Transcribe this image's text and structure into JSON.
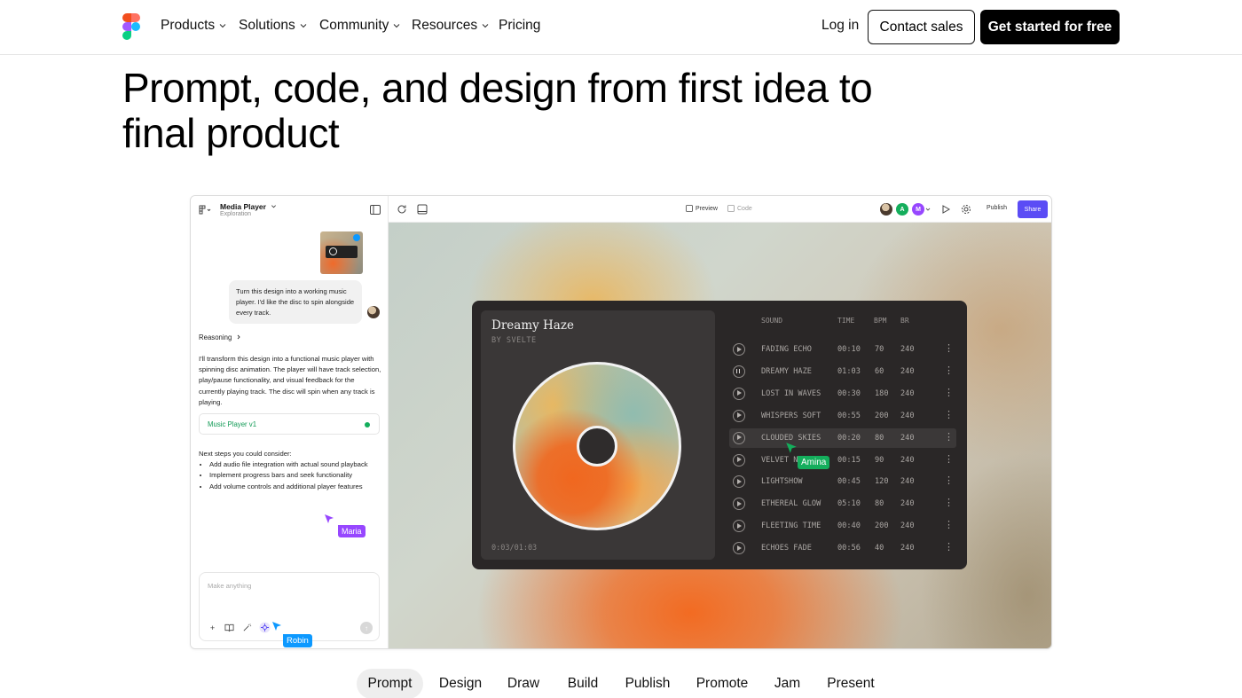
{
  "nav": {
    "items": [
      "Products",
      "Solutions",
      "Community",
      "Resources",
      "Pricing"
    ],
    "login": "Log in",
    "contact": "Contact sales",
    "cta": "Get started for free"
  },
  "hero": {
    "line1": "Prompt, code, and design from first idea to",
    "line2": "final product"
  },
  "app": {
    "project_title": "Media Player",
    "project_subtitle": "Exploration",
    "user_message": "Turn this design into a working music player. I'd like the disc to spin alongside every track.",
    "reasoning_label": "Reasoning",
    "response": "I'll transform this design into a functional music player with spinning disc animation. The player will have track selection, play/pause functionality, and visual feedback for the currently playing track. The disc will spin when any track is playing.",
    "card_label": "Music Player v1",
    "next_intro": "Next steps you could consider:",
    "next_steps": [
      "Add audio file integration with actual sound playback",
      "Implement progress bars and seek functionality",
      "Add volume controls and additional player features"
    ],
    "input_placeholder": "Make anything",
    "cursors": {
      "maria": "Maria",
      "robin": "Robin",
      "amina": "Amina"
    },
    "topbar": {
      "preview": "Preview",
      "code": "Code",
      "avatar_a": "A",
      "avatar_m": "M",
      "publish": "Publish",
      "share": "Share"
    },
    "colors": {
      "share": "#5b4cf5",
      "maria": "#9747ff",
      "robin": "#0d99ff",
      "amina": "#14ae5c",
      "card_dot": "#14ae5c"
    }
  },
  "player": {
    "title": "Dreamy Haze",
    "artist": "BY SVELTE",
    "time": "0:03/01:03",
    "columns": [
      "SOUND",
      "TIME",
      "BPM",
      "BR"
    ],
    "tracks": [
      {
        "name": "FADING ECHO",
        "time": "00:10",
        "bpm": "70",
        "br": "240"
      },
      {
        "name": "DREAMY HAZE",
        "time": "01:03",
        "bpm": "60",
        "br": "240"
      },
      {
        "name": "LOST IN WAVES",
        "time": "00:30",
        "bpm": "180",
        "br": "240"
      },
      {
        "name": "WHISPERS SOFT",
        "time": "00:55",
        "bpm": "200",
        "br": "240"
      },
      {
        "name": "CLOUDED SKIES",
        "time": "00:20",
        "bpm": "80",
        "br": "240"
      },
      {
        "name": "VELVET N",
        "time": "00:15",
        "bpm": "90",
        "br": "240"
      },
      {
        "name": "LIGHTSHOW",
        "time": "00:45",
        "bpm": "120",
        "br": "240"
      },
      {
        "name": "ETHEREAL GLOW",
        "time": "05:10",
        "bpm": "80",
        "br": "240"
      },
      {
        "name": "FLEETING TIME",
        "time": "00:40",
        "bpm": "200",
        "br": "240"
      },
      {
        "name": "ECHOES FADE",
        "time": "00:56",
        "bpm": "40",
        "br": "240"
      }
    ]
  },
  "tabs": [
    "Prompt",
    "Design",
    "Draw",
    "Build",
    "Publish",
    "Promote",
    "Jam",
    "Present"
  ],
  "active_tab": "Prompt"
}
